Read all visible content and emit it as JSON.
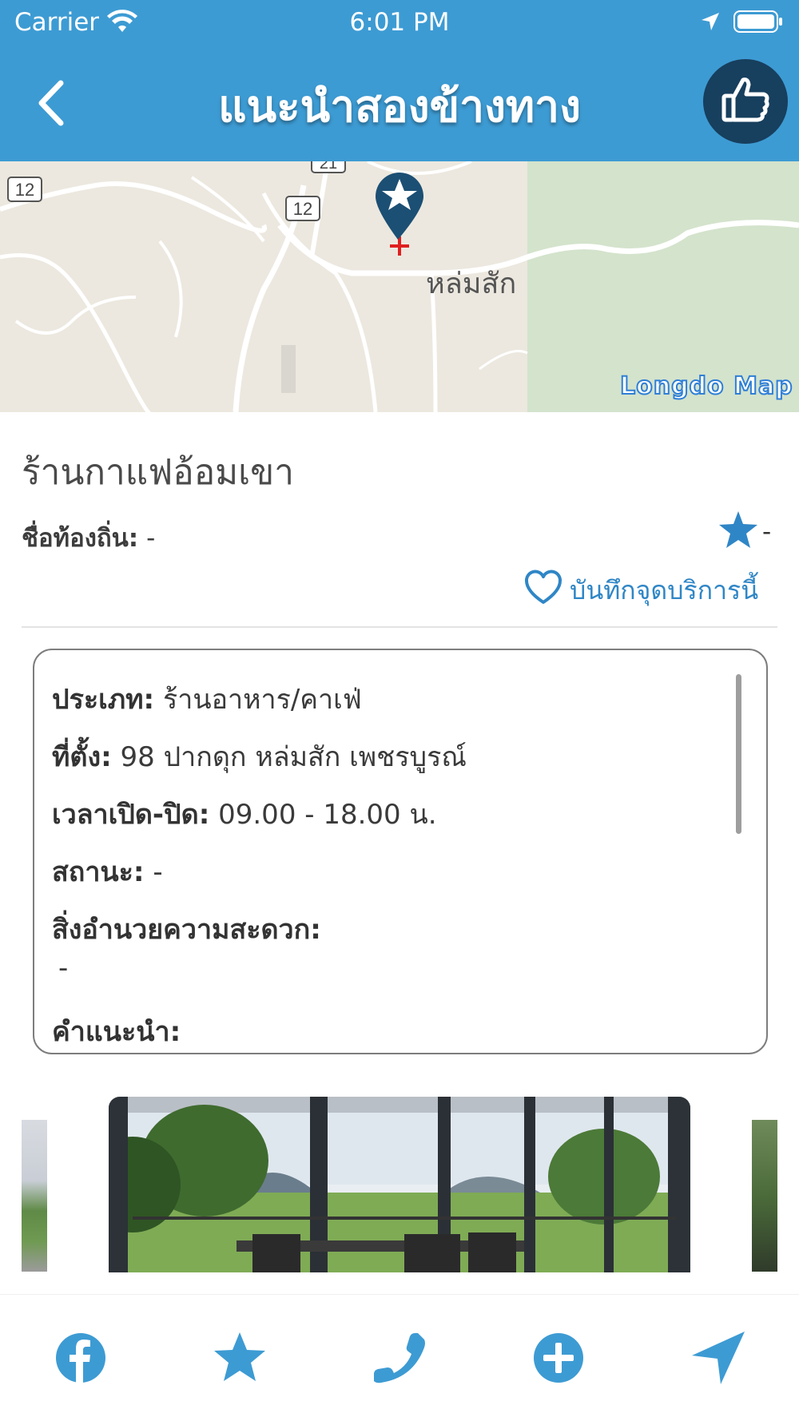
{
  "status_bar": {
    "carrier": "Carrier",
    "time": "6:01 PM"
  },
  "header": {
    "title": "แนะนำสองข้างทาง"
  },
  "map": {
    "place_label": "หล่มสัก",
    "road_shields": [
      "12",
      "12",
      "21"
    ],
    "watermark": "Longdo Map"
  },
  "place": {
    "title": "ร้านกาแฟอ้อมเขา",
    "local_name_label": "ชื่อท้องถิ่น:",
    "local_name_value": "-",
    "rating_value": "-",
    "save_label": "บันทึกจุดบริการนี้"
  },
  "details": {
    "type_label": "ประเภท:",
    "type_value": "ร้านอาหาร/คาเฟ่",
    "location_label": "ที่ตั้ง:",
    "location_value": "98 ปากดุก หล่มสัก เพชรบูรณ์",
    "hours_label": "เวลาเปิด-ปิด:",
    "hours_value": "09.00 - 18.00 น.",
    "status_label": "สถานะ:",
    "status_value": "-",
    "facilities_label": "สิ่งอำนวยความสะดวก:",
    "facilities_value": "-",
    "advice_label": "คำแนะนำ:"
  },
  "toolbar": {
    "icons": [
      "facebook-icon",
      "star-icon",
      "phone-icon",
      "plus-circle-icon",
      "navigate-icon"
    ]
  },
  "colors": {
    "primary": "#3d9bd3",
    "dark": "#173f5e",
    "accent": "#2f86c6"
  }
}
